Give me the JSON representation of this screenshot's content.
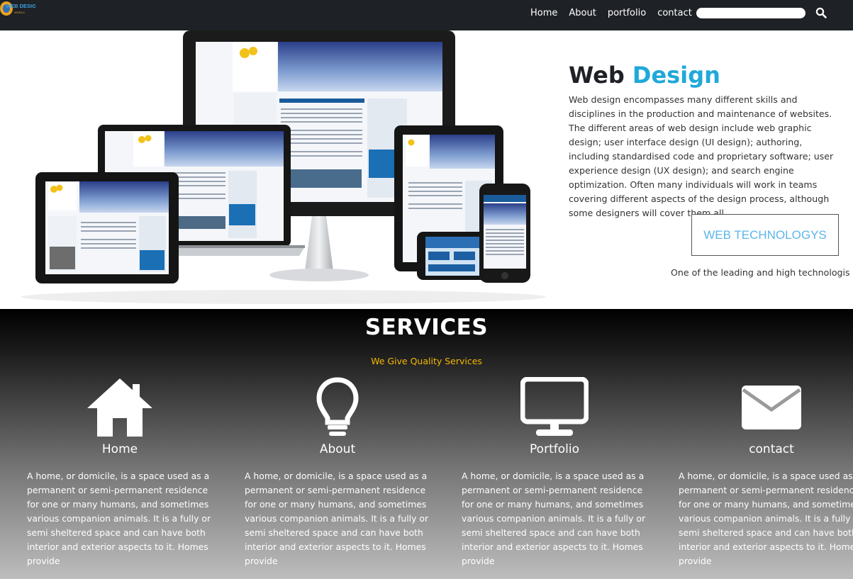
{
  "navbar": {
    "logo_text_top": "WEB DESIGN",
    "logo_text_bottom": "WORLD",
    "links": [
      "Home",
      "About",
      "portfolio",
      "contact"
    ],
    "search_placeholder": "",
    "search_icon": "search-icon"
  },
  "hero": {
    "title_part1": "Web",
    "title_part2": "Design",
    "description": "Web design encompasses many different skills and disciplines in the production and maintenance of websites. The different areas of web design include web graphic design; user interface design (UI design); authoring, including standardised code and proprietary software; user experience design (UX design); and search engine optimization. Often many individuals will work in teams covering different aspects of the design process, although some designers will cover them all",
    "button_label": "WEB TECHNOLOGYS",
    "tagline": "One of the leading and high technologis",
    "accent_color": "#1fa9d9"
  },
  "services": {
    "title": "SERVICES",
    "subtitle": "We Give Quality Services",
    "subtitle_color": "#f5b800",
    "items": [
      {
        "icon": "home-icon",
        "title": "Home",
        "text": "A home, or domicile, is a space used as a permanent or semi-permanent residence for one or many humans, and sometimes various companion animals. It is a fully or semi sheltered space and can have both interior and exterior aspects to it. Homes provide"
      },
      {
        "icon": "lightbulb-icon",
        "title": "About",
        "text": "A home, or domicile, is a space used as a permanent or semi-permanent residence for one or many humans, and sometimes various companion animals. It is a fully or semi sheltered space and can have both interior and exterior aspects to it. Homes provide"
      },
      {
        "icon": "monitor-icon",
        "title": "Portfolio",
        "text": "A home, or domicile, is a space used as a permanent or semi-permanent residence for one or many humans, and sometimes various companion animals. It is a fully or semi sheltered space and can have both interior and exterior aspects to it. Homes provide"
      },
      {
        "icon": "envelope-icon",
        "title": "contact",
        "text": "A home, or domicile, is a space used as a permanent or semi-permanent residence for one or many humans, and sometimes various companion animals. It is a fully or semi sheltered space and can have both interior and exterior aspects to it. Homes provide"
      }
    ]
  }
}
